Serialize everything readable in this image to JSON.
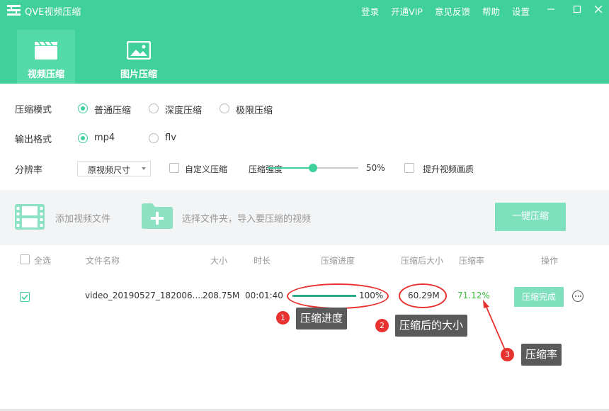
{
  "app": {
    "title": "QVE视频压缩"
  },
  "topmenu": [
    "登录",
    "开通VIP",
    "意见反馈",
    "帮助",
    "设置"
  ],
  "tabs": [
    {
      "label": "视频压缩",
      "active": true
    },
    {
      "label": "图片压缩",
      "active": false
    }
  ],
  "settings": {
    "mode": {
      "label": "压缩模式",
      "options": [
        "普通压缩",
        "深度压缩",
        "极限压缩"
      ],
      "selected": "普通压缩"
    },
    "format": {
      "label": "输出格式",
      "options": [
        "mp4",
        "flv"
      ],
      "selected": "mp4"
    },
    "resolution": {
      "label": "分辨率",
      "value": "原视频尺寸",
      "custom_label": "自定义压缩",
      "custom_checked": false,
      "strength_label": "压缩强度",
      "strength_value": 0.5,
      "strength_text": "50%",
      "enhance_label": "提升视频画质",
      "enhance_checked": false
    }
  },
  "import": {
    "add_label": "添加视频文件",
    "folder_label": "选择文件夹，导入要压缩的视频",
    "compress_button": "一键压缩"
  },
  "table": {
    "select_all": "全选",
    "headers": [
      "文件名称",
      "大小",
      "时长",
      "压缩进度",
      "压缩后大小",
      "压缩率",
      "操作"
    ],
    "rows": [
      {
        "checked": true,
        "name": "video_20190527_182006....",
        "size": "208.75M",
        "duration": "00:01:40",
        "progress": 1.0,
        "progress_text": "100%",
        "compressed_size": "60.29M",
        "ratio": "71.12%",
        "action": "压缩完成"
      }
    ]
  },
  "annotations": [
    {
      "number": "1",
      "label": "压缩进度"
    },
    {
      "number": "2",
      "label": "压缩后的大小"
    },
    {
      "number": "3",
      "label": "压缩率"
    }
  ],
  "colors": {
    "brand": "#3fd09c",
    "accent_light": "#7fe0bd",
    "annotation": "#e8322f",
    "ratio_text": "#3bbf3b"
  }
}
